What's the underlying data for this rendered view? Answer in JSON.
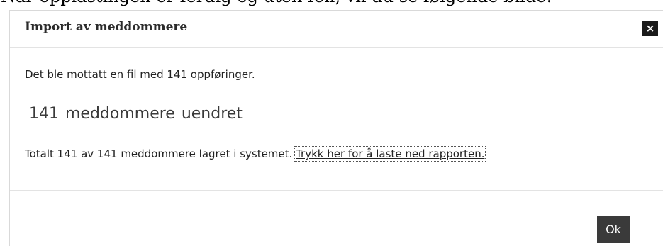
{
  "document": {
    "intro_text": "Når opplastingen er ferdig og uten feil, vil du se følgende bilde:"
  },
  "dialog": {
    "title": "Import av meddommere",
    "close_icon": "close-icon",
    "close_glyph": "×",
    "received_text": "Det ble mottatt en fil med 141 oppføringer.",
    "unchanged_text": "141  meddommere uendret",
    "total_text": "Totalt 141 av 141 meddommere lagret i systemet.",
    "report_link_text": "Trykk her for å laste ned rapporten.",
    "ok_label": "Ok"
  },
  "colors": {
    "close_button_bg": "#1a1a1a",
    "ok_button_bg": "#3a3a3a",
    "divider": "#e3e3e3"
  }
}
